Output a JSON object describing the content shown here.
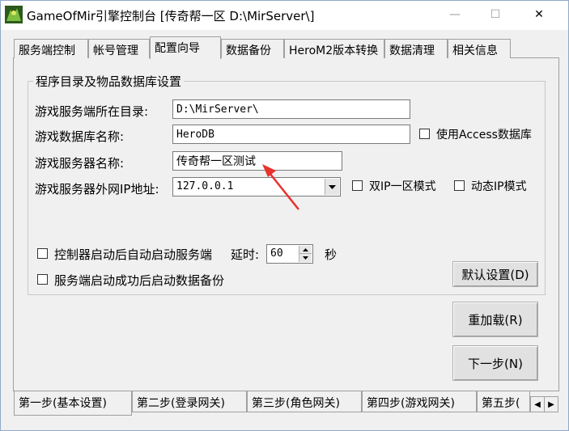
{
  "window": {
    "title": "GameOfMir引擎控制台 [传奇帮一区 D:\\MirServer\\]",
    "minimize_glyph": "—",
    "maximize_glyph": "☐",
    "close_glyph": "✕"
  },
  "top_tabs": [
    {
      "label": "服务端控制"
    },
    {
      "label": "帐号管理"
    },
    {
      "label": "配置向导"
    },
    {
      "label": "数据备份"
    },
    {
      "label": "HeroM2版本转换"
    },
    {
      "label": "数据清理"
    },
    {
      "label": "相关信息"
    }
  ],
  "group": {
    "title": "程序目录及物品数据库设置"
  },
  "form": {
    "server_dir_label": "游戏服务端所在目录:",
    "server_dir_value": "D:\\MirServer\\",
    "db_name_label": "游戏数据库名称:",
    "db_name_value": "HeroDB",
    "use_access_label": "使用Access数据库",
    "server_name_label": "游戏服务器名称:",
    "server_name_value": "传奇帮一区测试",
    "external_ip_label": "游戏服务器外网IP地址:",
    "external_ip_value": "127.0.0.1",
    "dual_ip_label": "双IP一区模式",
    "dynamic_ip_label": "动态IP模式",
    "autostart_label": "控制器启动后自动启动服务端",
    "delay_label": "延时:",
    "delay_value": "60",
    "seconds_label": "秒",
    "backup_label": "服务端启动成功后启动数据备份"
  },
  "buttons": {
    "default_settings": "默认设置(D)",
    "reload": "重加载(R)",
    "next_step": "下一步(N)"
  },
  "bottom_tabs": [
    {
      "label": "第一步(基本设置)"
    },
    {
      "label": "第二步(登录网关)"
    },
    {
      "label": "第三步(角色网关)"
    },
    {
      "label": "第四步(游戏网关)"
    },
    {
      "label": "第五步("
    }
  ],
  "colors": {
    "annotation_arrow": "#e8322c"
  }
}
